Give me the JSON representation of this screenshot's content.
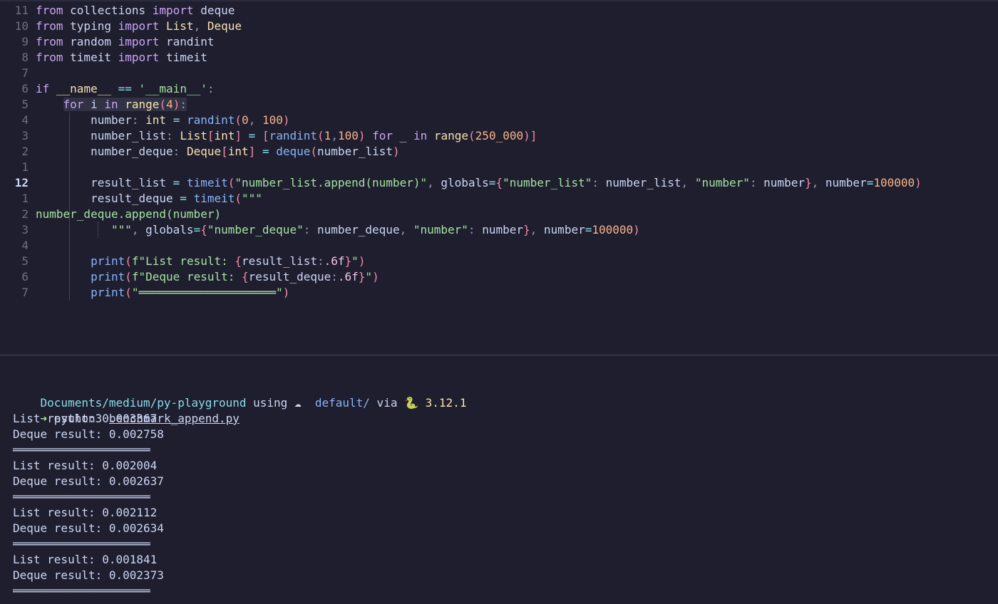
{
  "editor": {
    "lines": [
      {
        "num": "11",
        "tokens": [
          [
            "kw",
            "from"
          ],
          [
            "tx",
            " collections "
          ],
          [
            "kw",
            "import"
          ],
          [
            "tx",
            " deque"
          ]
        ]
      },
      {
        "num": "10",
        "tokens": [
          [
            "kw",
            "from"
          ],
          [
            "tx",
            " typing "
          ],
          [
            "kw",
            "import"
          ],
          [
            "tx",
            " "
          ],
          [
            "ty",
            "List"
          ],
          [
            "pu",
            ","
          ],
          [
            "tx",
            " "
          ],
          [
            "ty",
            "Deque"
          ]
        ]
      },
      {
        "num": "9",
        "tokens": [
          [
            "kw",
            "from"
          ],
          [
            "tx",
            " random "
          ],
          [
            "kw",
            "import"
          ],
          [
            "tx",
            " randint"
          ]
        ]
      },
      {
        "num": "8",
        "tokens": [
          [
            "kw",
            "from"
          ],
          [
            "tx",
            " timeit "
          ],
          [
            "kw",
            "import"
          ],
          [
            "tx",
            " timeit"
          ]
        ]
      },
      {
        "num": "7",
        "tokens": []
      },
      {
        "num": "6",
        "tokens": [
          [
            "kw",
            "if"
          ],
          [
            "tx",
            " "
          ],
          [
            "ty",
            "__name__"
          ],
          [
            "tx",
            " "
          ],
          [
            "op",
            "=="
          ],
          [
            "tx",
            " "
          ],
          [
            "st",
            "'__main__'"
          ],
          [
            "pu",
            ":"
          ]
        ]
      },
      {
        "num": "5",
        "tokens": [
          [
            "tx",
            "    "
          ],
          [
            "kw",
            "for"
          ],
          [
            "tx",
            " i "
          ],
          [
            "kw",
            "in"
          ],
          [
            "tx",
            " "
          ],
          [
            "ty",
            "range"
          ],
          [
            "br",
            "("
          ],
          [
            "nm",
            "4"
          ],
          [
            "br",
            ")"
          ],
          [
            "pu",
            ":"
          ]
        ]
      },
      {
        "num": "4",
        "tokens": [
          [
            "tx",
            "        number"
          ],
          [
            "pu",
            ":"
          ],
          [
            "tx",
            " "
          ],
          [
            "ty",
            "int"
          ],
          [
            "tx",
            " "
          ],
          [
            "op",
            "="
          ],
          [
            "tx",
            " "
          ],
          [
            "fn",
            "randint"
          ],
          [
            "br",
            "("
          ],
          [
            "nm",
            "0"
          ],
          [
            "pu",
            ","
          ],
          [
            "tx",
            " "
          ],
          [
            "nm",
            "100"
          ],
          [
            "br",
            ")"
          ]
        ]
      },
      {
        "num": "3",
        "tokens": [
          [
            "tx",
            "        number_list"
          ],
          [
            "pu",
            ":"
          ],
          [
            "tx",
            " "
          ],
          [
            "ty",
            "List"
          ],
          [
            "br",
            "["
          ],
          [
            "ty",
            "int"
          ],
          [
            "br",
            "]"
          ],
          [
            "tx",
            " "
          ],
          [
            "op",
            "="
          ],
          [
            "tx",
            " "
          ],
          [
            "br",
            "["
          ],
          [
            "fn",
            "randint"
          ],
          [
            "br",
            "("
          ],
          [
            "nm",
            "1"
          ],
          [
            "pu",
            ","
          ],
          [
            "nm",
            "100"
          ],
          [
            "br",
            ")"
          ],
          [
            "tx",
            " "
          ],
          [
            "kw",
            "for"
          ],
          [
            "tx",
            " _ "
          ],
          [
            "kw",
            "in"
          ],
          [
            "tx",
            " "
          ],
          [
            "ty",
            "range"
          ],
          [
            "br",
            "("
          ],
          [
            "nm",
            "250_000"
          ],
          [
            "br",
            ")"
          ],
          [
            "br",
            "]"
          ]
        ]
      },
      {
        "num": "2",
        "tokens": [
          [
            "tx",
            "        number_deque"
          ],
          [
            "pu",
            ":"
          ],
          [
            "tx",
            " "
          ],
          [
            "ty",
            "Deque"
          ],
          [
            "br",
            "["
          ],
          [
            "ty",
            "int"
          ],
          [
            "br",
            "]"
          ],
          [
            "tx",
            " "
          ],
          [
            "op",
            "="
          ],
          [
            "tx",
            " "
          ],
          [
            "fn",
            "deque"
          ],
          [
            "br",
            "("
          ],
          [
            "tx",
            "number_list"
          ],
          [
            "br",
            ")"
          ]
        ]
      },
      {
        "num": "1",
        "tokens": []
      },
      {
        "num": "12",
        "current": true,
        "tokens": [
          [
            "tx",
            "        result_list "
          ],
          [
            "op",
            "="
          ],
          [
            "tx",
            " "
          ],
          [
            "fn",
            "timeit"
          ],
          [
            "br",
            "("
          ],
          [
            "st",
            "\"number_list.append(number)\""
          ],
          [
            "pu",
            ","
          ],
          [
            "tx",
            " globals"
          ],
          [
            "op",
            "="
          ],
          [
            "br",
            "{"
          ],
          [
            "st",
            "\"number_list\""
          ],
          [
            "pu",
            ":"
          ],
          [
            "tx",
            " number_list"
          ],
          [
            "pu",
            ","
          ],
          [
            "tx",
            " "
          ],
          [
            "st",
            "\"number\""
          ],
          [
            "pu",
            ":"
          ],
          [
            "tx",
            " number"
          ],
          [
            "br",
            "}"
          ],
          [
            "pu",
            ","
          ],
          [
            "tx",
            " number"
          ],
          [
            "op",
            "="
          ],
          [
            "nm",
            "100000"
          ],
          [
            "br",
            ")"
          ]
        ]
      },
      {
        "num": "1",
        "tokens": [
          [
            "tx",
            "        result_deque "
          ],
          [
            "op",
            "="
          ],
          [
            "tx",
            " "
          ],
          [
            "fn",
            "timeit"
          ],
          [
            "br",
            "("
          ],
          [
            "st",
            "\"\"\""
          ]
        ]
      },
      {
        "num": "2",
        "tokens": [
          [
            "st",
            "number_deque.append(number)"
          ]
        ]
      },
      {
        "num": "3",
        "tokens": [
          [
            "st",
            "           \"\"\""
          ],
          [
            "pu",
            ","
          ],
          [
            "tx",
            " globals"
          ],
          [
            "op",
            "="
          ],
          [
            "br",
            "{"
          ],
          [
            "st",
            "\"number_deque\""
          ],
          [
            "pu",
            ":"
          ],
          [
            "tx",
            " number_deque"
          ],
          [
            "pu",
            ","
          ],
          [
            "tx",
            " "
          ],
          [
            "st",
            "\"number\""
          ],
          [
            "pu",
            ":"
          ],
          [
            "tx",
            " number"
          ],
          [
            "br",
            "}"
          ],
          [
            "pu",
            ","
          ],
          [
            "tx",
            " number"
          ],
          [
            "op",
            "="
          ],
          [
            "nm",
            "100000"
          ],
          [
            "br",
            ")"
          ]
        ]
      },
      {
        "num": "4",
        "tokens": []
      },
      {
        "num": "5",
        "tokens": [
          [
            "tx",
            "        "
          ],
          [
            "fn",
            "print"
          ],
          [
            "br",
            "("
          ],
          [
            "st",
            "f\"List result: "
          ],
          [
            "br",
            "{"
          ],
          [
            "tx",
            "result_list"
          ],
          [
            "pu",
            ":"
          ],
          [
            "ds",
            ".6f"
          ],
          [
            "br",
            "}"
          ],
          [
            "st",
            "\""
          ],
          [
            "br",
            ")"
          ]
        ]
      },
      {
        "num": "6",
        "tokens": [
          [
            "tx",
            "        "
          ],
          [
            "fn",
            "print"
          ],
          [
            "br",
            "("
          ],
          [
            "st",
            "f\"Deque result: "
          ],
          [
            "br",
            "{"
          ],
          [
            "tx",
            "result_deque"
          ],
          [
            "pu",
            ":"
          ],
          [
            "ds",
            ".6f"
          ],
          [
            "br",
            "}"
          ],
          [
            "st",
            "\""
          ],
          [
            "br",
            ")"
          ]
        ]
      },
      {
        "num": "7",
        "tokens": [
          [
            "tx",
            "        "
          ],
          [
            "fn",
            "print"
          ],
          [
            "br",
            "("
          ],
          [
            "st",
            "\"════════════════════\""
          ],
          [
            "br",
            ")"
          ]
        ]
      }
    ]
  },
  "terminal": {
    "prompt": {
      "path": "Documents/medium/py-playground",
      "using": " using ",
      "cloud": "☁",
      "env": "  default/",
      "via": " via ",
      "snake": "🐍",
      "version": " 3.12.1"
    },
    "command": {
      "arrow": "➜",
      "cmd": " python3 ",
      "file": "benchmark_append.py"
    },
    "output": [
      "List result: 0.003367",
      "Deque result: 0.002758",
      "════════════════════",
      "List result: 0.002004",
      "Deque result: 0.002637",
      "════════════════════",
      "List result: 0.002112",
      "Deque result: 0.002634",
      "════════════════════",
      "List result: 0.001841",
      "Deque result: 0.002373",
      "════════════════════"
    ]
  }
}
